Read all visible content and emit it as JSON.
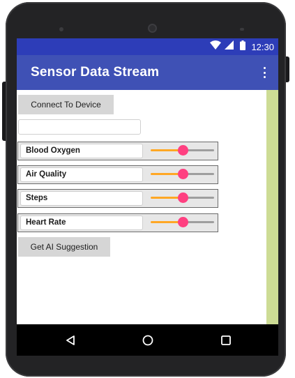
{
  "status_bar": {
    "time": "12:30",
    "icons": [
      "wifi-icon",
      "signal-icon",
      "battery-icon"
    ]
  },
  "app_bar": {
    "title": "Sensor Data Stream",
    "menu_icon": "overflow-menu-icon"
  },
  "main": {
    "connect_button": "Connect To Device",
    "input_value": "",
    "sensors": [
      {
        "label": "Blood Oxygen",
        "slider_value": 0.5
      },
      {
        "label": "Air Quality",
        "slider_value": 0.5
      },
      {
        "label": "Steps",
        "slider_value": 0.5
      },
      {
        "label": "Heart Rate",
        "slider_value": 0.5
      }
    ],
    "ai_button": "Get AI Suggestion"
  },
  "nav_bar": {
    "icons": [
      "back-icon",
      "home-icon",
      "recents-icon"
    ]
  },
  "colors": {
    "status_bar": "#2d3db8",
    "app_bar": "#3f51b5",
    "slider_active": "#ffa724",
    "slider_thumb": "#ff4081",
    "scroll_strip": "#cddc95"
  }
}
